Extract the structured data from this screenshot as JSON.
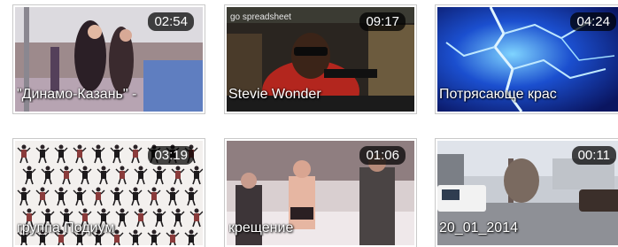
{
  "videos": [
    {
      "title": "\"Динамо-Казань\" -",
      "duration": "02:54"
    },
    {
      "title": "Stevie Wonder",
      "duration": "09:17",
      "overlay_text": "go spreadsheet"
    },
    {
      "title": "Потрясающе крас",
      "duration": "04:24"
    },
    {
      "title": "группа Подиум",
      "duration": "03:19"
    },
    {
      "title": "крещение",
      "duration": "01:06"
    },
    {
      "title": "20_01_2014",
      "duration": "00:11"
    }
  ]
}
